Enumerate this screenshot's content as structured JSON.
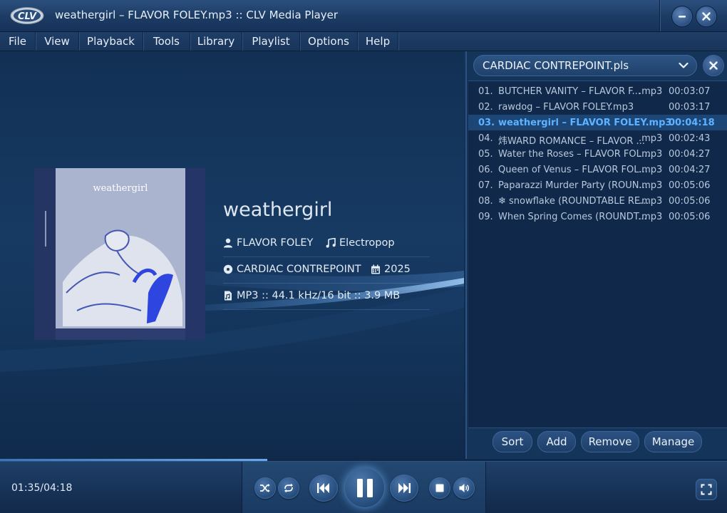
{
  "window": {
    "title": "weathergirl  – FLAVOR FOLEY.mp3 :: CLV Media Player",
    "logo_text": "CLV"
  },
  "menu": [
    "File",
    "View",
    "Playback",
    "Tools",
    "Library",
    "Playlist",
    "Options",
    "Help"
  ],
  "now_playing": {
    "title": "weathergirl",
    "artist": "FLAVOR FOLEY",
    "genre": "Electropop",
    "album": "CARDIAC CONTREPOINT",
    "year": "2025",
    "format": "MP3 :: 44.1 kHz/16 bit :: 3.9 MB",
    "album_art_text": "weathergirl"
  },
  "playlist": {
    "name": "CARDIAC CONTREPOINT.pls",
    "items": [
      {
        "num": "01.",
        "name": "BUTCHER VANITY – FLAVOR F...",
        "ext": ".mp3",
        "duration": "00:03:07",
        "active": false
      },
      {
        "num": "02.",
        "name": "rawdog – FLAVOR FOLEY.mp3",
        "ext": "",
        "duration": "00:03:17",
        "active": false
      },
      {
        "num": "03.",
        "name": "weathergirl  – FLAVOR FOLEY.mp3",
        "ext": "",
        "duration": "00:04:18",
        "active": true
      },
      {
        "num": "04.",
        "name": "炜WARD ROMANCE – FLAVOR ...",
        "ext": ".mp3",
        "duration": "00:02:43",
        "active": false
      },
      {
        "num": "05.",
        "name": "Water the Roses – FLAVOR FOL...",
        "ext": ".mp3",
        "duration": "00:04:27",
        "active": false
      },
      {
        "num": "06.",
        "name": "Queen of Venus – FLAVOR FOL...",
        "ext": ".mp3",
        "duration": "00:04:27",
        "active": false
      },
      {
        "num": "07.",
        "name": "Paparazzi Murder Party (ROUN...",
        "ext": ".mp3",
        "duration": "00:05:06",
        "active": false
      },
      {
        "num": "08.",
        "name": "❄ snowflake (ROUNDTABLE RE...",
        "ext": ".mp3",
        "duration": "00:05:06",
        "active": false
      },
      {
        "num": "09.",
        "name": "When Spring Comes (ROUNDT...",
        "ext": ".mp3",
        "duration": "00:05:06",
        "active": false
      }
    ],
    "buttons": {
      "sort": "Sort",
      "add": "Add",
      "remove": "Remove",
      "manage": "Manage"
    }
  },
  "playback": {
    "time": "01:35/04:18",
    "progress": 0.368
  },
  "colors": {
    "accent": "#5fb2ff",
    "background": "#17355a"
  }
}
